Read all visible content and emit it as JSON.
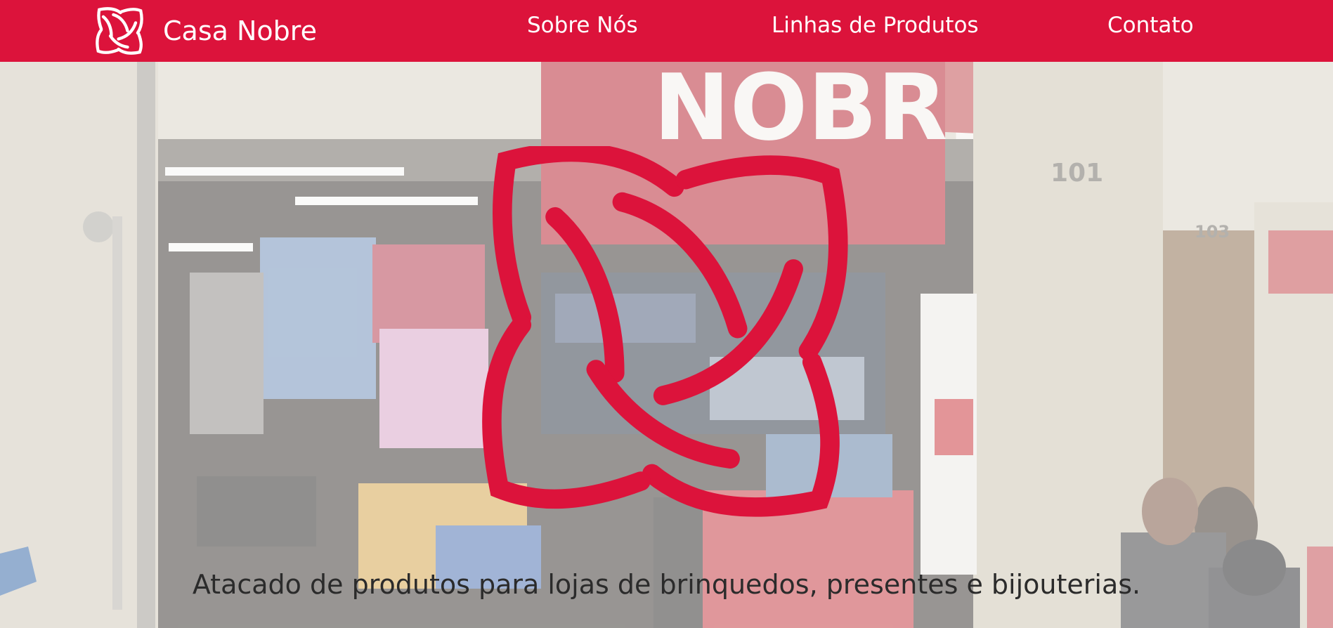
{
  "brand": {
    "name": "Casa Nobre",
    "logo_icon": "casa-nobre-knot-icon"
  },
  "nav": {
    "about": "Sobre Nós",
    "products": "Linhas de Produtos",
    "contact": "Contato"
  },
  "hero": {
    "storefront_sign": "NOBRE",
    "door_numbers": [
      "101",
      "103"
    ],
    "tagline": "Atacado de produtos para lojas de brinquedos, presentes e bijouterias."
  },
  "colors": {
    "brand_red": "#dc133b",
    "text_dark": "#2b2b2b",
    "nav_text": "#ffffff"
  }
}
